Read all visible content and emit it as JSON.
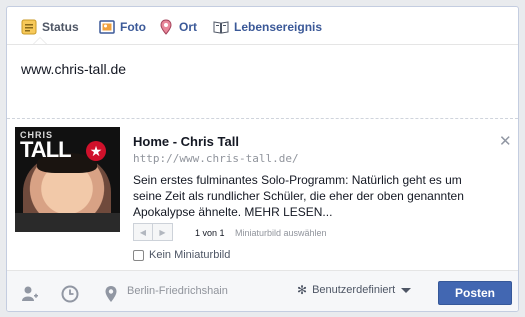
{
  "tabs": [
    {
      "label": "Status",
      "icon": "status-icon",
      "active": true
    },
    {
      "label": "Foto",
      "icon": "photo-icon",
      "active": false
    },
    {
      "label": "Ort",
      "icon": "location-pin-icon",
      "active": false
    },
    {
      "label": "Lebensereignis",
      "icon": "life-event-icon",
      "active": false
    }
  ],
  "composer": {
    "text": "www.chris-tall.de"
  },
  "preview": {
    "thumb_logo_small": "CHRIS",
    "thumb_logo_big": "TALL",
    "title": "Home - Chris Tall",
    "url": "http://www.chris-tall.de/",
    "description": "Sein erstes fulminantes Solo-Programm: Natürlich geht es um seine Zeit als rundlicher Schüler, die eher der oben genannten Apokalypse ähnelte. MEHR LESEN...",
    "close_glyph": "✕",
    "thumb_count": "1 von 1",
    "choose_thumb": "Miniaturbild auswählen",
    "no_thumb_label": "Kein Miniaturbild"
  },
  "footer": {
    "location_placeholder": "Berlin-Friedrichshain",
    "privacy_label": "Benutzerdefiniert",
    "post_button": "Posten"
  },
  "colors": {
    "brand_blue": "#3b5998",
    "button_blue": "#4267b2"
  }
}
